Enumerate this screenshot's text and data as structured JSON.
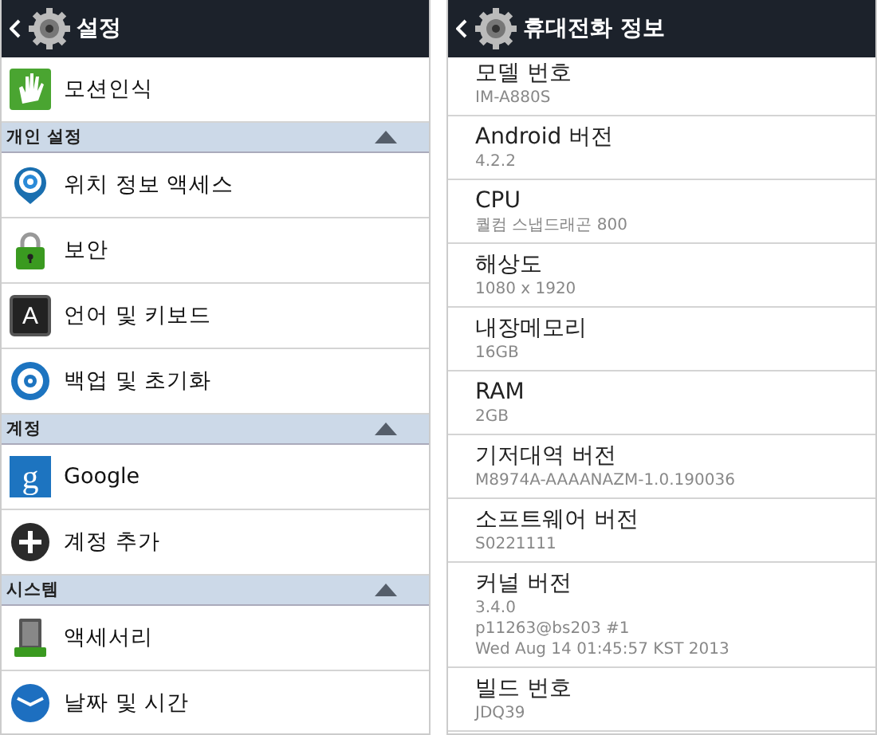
{
  "left": {
    "title": "설정",
    "list": [
      {
        "kind": "item",
        "label": "모션인식"
      },
      {
        "kind": "section",
        "label": "개인 설정",
        "expanded": true
      },
      {
        "kind": "item",
        "label": "위치 정보 액세스"
      },
      {
        "kind": "item",
        "label": "보안"
      },
      {
        "kind": "item",
        "glyph": "A",
        "label": "언어 및 키보드"
      },
      {
        "kind": "item",
        "label": "백업 및 초기화"
      },
      {
        "kind": "section",
        "label": "계정",
        "expanded": true
      },
      {
        "kind": "item",
        "glyph": "g",
        "label": "Google"
      },
      {
        "kind": "item",
        "label": "계정 추가"
      },
      {
        "kind": "section",
        "label": "시스템",
        "expanded": true
      },
      {
        "kind": "item",
        "label": "액세서리"
      },
      {
        "kind": "item",
        "label": "날짜 및 시간"
      }
    ]
  },
  "right": {
    "title": "휴대전화 정보",
    "rows": [
      {
        "label": "모델 번호",
        "values": [
          "IM-A880S"
        ]
      },
      {
        "label": "Android 버전",
        "values": [
          "4.2.2"
        ]
      },
      {
        "label": "CPU",
        "values": [
          "퀄컴 스냅드래곤 800"
        ]
      },
      {
        "label": "해상도",
        "values": [
          "1080 x 1920"
        ]
      },
      {
        "label": "내장메모리",
        "values": [
          "16GB"
        ]
      },
      {
        "label": "RAM",
        "values": [
          "2GB"
        ]
      },
      {
        "label": "기저대역 버전",
        "values": [
          "M8974A-AAAANAZM-1.0.190036"
        ]
      },
      {
        "label": "소프트웨어 버전",
        "values": [
          "S0221111"
        ]
      },
      {
        "label": "커널 버전",
        "values": [
          "3.4.0",
          "p11263@bs203 #1",
          "Wed Aug 14 01:45:57 KST 2013"
        ]
      },
      {
        "label": "빌드 번호",
        "values": [
          "JDQ39"
        ]
      }
    ]
  }
}
